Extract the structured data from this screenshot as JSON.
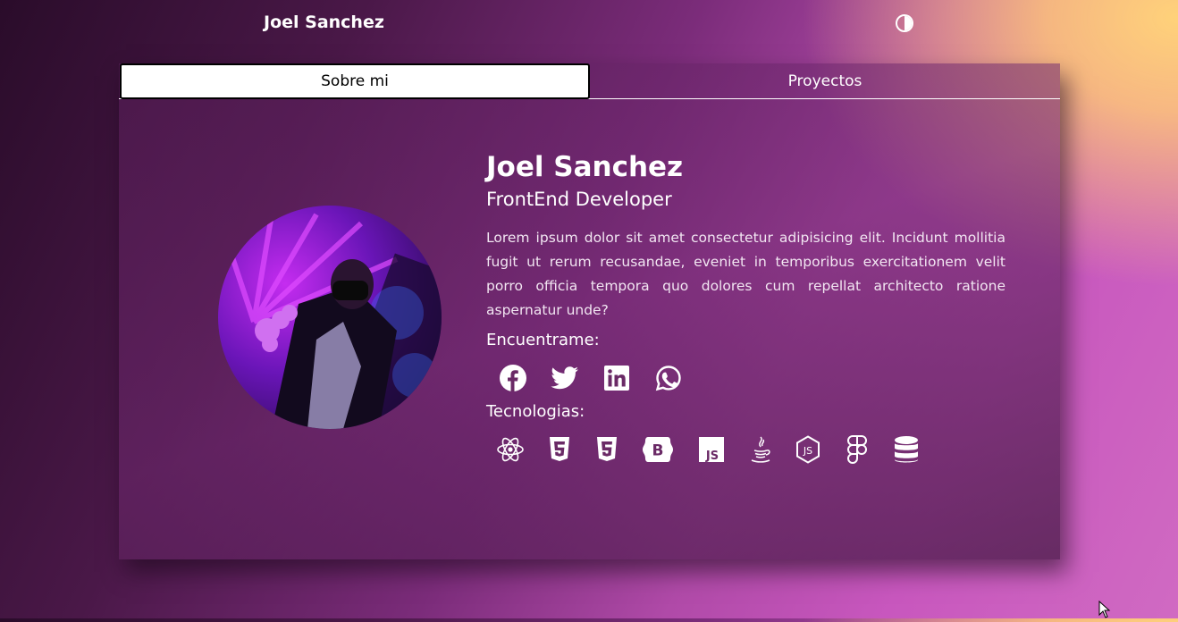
{
  "header": {
    "brand": "Joel Sanchez",
    "theme_toggle_icon": "contrast-icon"
  },
  "tabs": [
    {
      "label": "Sobre mi",
      "active": true
    },
    {
      "label": "Proyectos",
      "active": false
    }
  ],
  "profile": {
    "name": "Joel Sanchez",
    "role": "FrontEnd Developer",
    "description": "Lorem ipsum dolor sit amet consectetur adipisicing elit. Incidunt mollitia fugit ut rerum recusandae, eveniet in temporibus exercitationem velit porro officia tempora quo dolores cum repellat architecto ratione aspernatur unde?",
    "avatar_icon": "profile-photo"
  },
  "social": {
    "label": "Encuentrame:",
    "items": [
      "facebook-icon",
      "twitter-icon",
      "linkedin-icon",
      "whatsapp-icon"
    ]
  },
  "tech": {
    "label": "Tecnologias:",
    "items": [
      "react-icon",
      "html5-icon",
      "css3-icon",
      "bootstrap-icon",
      "javascript-icon",
      "java-icon",
      "nodejs-icon",
      "figma-icon",
      "database-icon"
    ]
  },
  "colors": {
    "accent": "#c857be",
    "warm": "#ffd27a",
    "dark": "#2a0c2a"
  }
}
